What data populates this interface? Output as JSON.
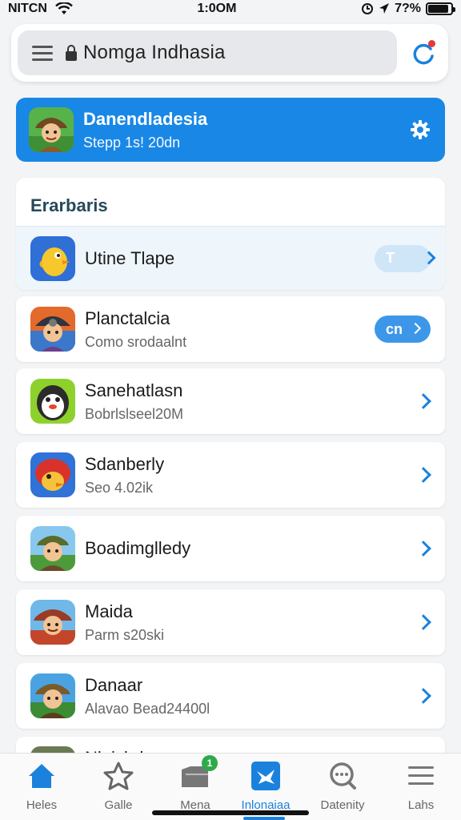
{
  "status_bar": {
    "carrier": "NITCN",
    "time": "1:0OM",
    "battery_text": "7?%",
    "battery_level": 0.9
  },
  "browser": {
    "url_text": "Nomga Indhasia",
    "menu_icon": "hamburger-icon",
    "lock_icon": "lock-icon",
    "reload_icon": "reload-icon"
  },
  "profile": {
    "name": "Danendladesia",
    "subtitle": "Stepp 1s! 20dn",
    "settings_icon": "gear-icon",
    "accent_color": "#1987e6"
  },
  "section": {
    "title": "Erarbaris"
  },
  "items": [
    {
      "title": "Utine Tlape",
      "subtitle": "",
      "action": "toggle-pill",
      "pill_text": "T",
      "icon": "yellow-bird-app-icon"
    },
    {
      "title": "Planctalcia",
      "subtitle": "Como srodaalnt",
      "action": "pill",
      "pill_text": "cn",
      "icon": "explorer-app-icon"
    },
    {
      "title": "Sanehatlasn",
      "subtitle": "Bobrlslseel20M",
      "action": "chevron",
      "icon": "penguin-app-icon"
    },
    {
      "title": "Sdanberly",
      "subtitle": "Seo 4.02ik",
      "action": "chevron",
      "icon": "red-bird-app-icon"
    },
    {
      "title": "Boadimglledy",
      "subtitle": "",
      "action": "chevron",
      "icon": "adventurer-app-icon"
    },
    {
      "title": "Maida",
      "subtitle": "Parm s20ski",
      "action": "chevron",
      "icon": "cowboy-app-icon"
    },
    {
      "title": "Danaar",
      "subtitle": "Alavao Bead24400l",
      "action": "chevron",
      "icon": "ranger-app-icon"
    },
    {
      "title": "Nlaisbd",
      "subtitle": "",
      "action": "chevron",
      "icon": "partial-app-icon"
    }
  ],
  "bottom_nav": [
    {
      "label": "Heles",
      "icon": "home-icon",
      "active": false
    },
    {
      "label": "Galle",
      "icon": "star-icon",
      "active": false
    },
    {
      "label": "Mena",
      "icon": "folder-icon",
      "active": false,
      "badge": "1"
    },
    {
      "label": "Inlonaiaa",
      "icon": "twitter-bird-icon",
      "active": true
    },
    {
      "label": "Datenity",
      "icon": "chat-search-icon",
      "active": false
    },
    {
      "label": "Lahs",
      "icon": "menu-lines-icon",
      "active": false
    }
  ],
  "colors": {
    "primary": "#1a82dc",
    "badge": "#2eaa4a",
    "notification_dot": "#e53935"
  }
}
